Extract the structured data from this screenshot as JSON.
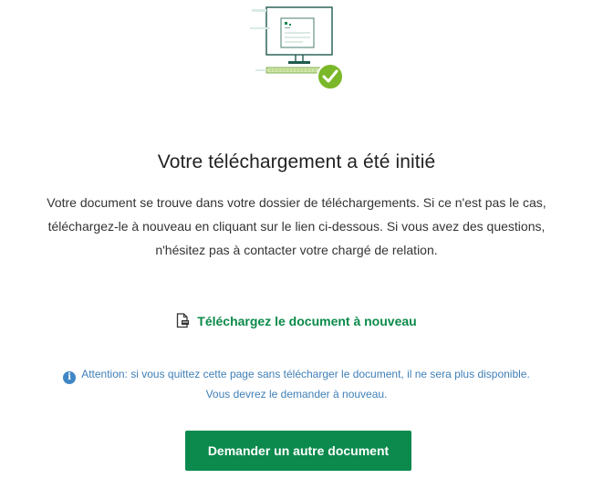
{
  "success": {
    "title": "Votre téléchargement a été initié",
    "message_line1": "Votre document se trouve dans votre dossier de téléchargements. Si ce n'est pas le cas,",
    "message_line2": "téléchargez-le à nouveau en cliquant sur le lien ci-dessous. Si vous avez des questions,",
    "message_line3": "n'hésitez pas à contacter votre chargé de relation."
  },
  "download_link": {
    "label": "Téléchargez le document à nouveau",
    "icon": "document-icon"
  },
  "notice": {
    "icon": "info-icon",
    "line1": "Attention: si vous quittez cette page sans télécharger le document, il ne sera plus disponible.",
    "line2": "Vous devrez le demander à nouveau."
  },
  "cta": {
    "label": "Demander un autre document"
  },
  "colors": {
    "accent": "#0c8a4e",
    "link": "#0a8a4a",
    "notice": "#3f7fb7",
    "success_badge": "#7ab829"
  }
}
